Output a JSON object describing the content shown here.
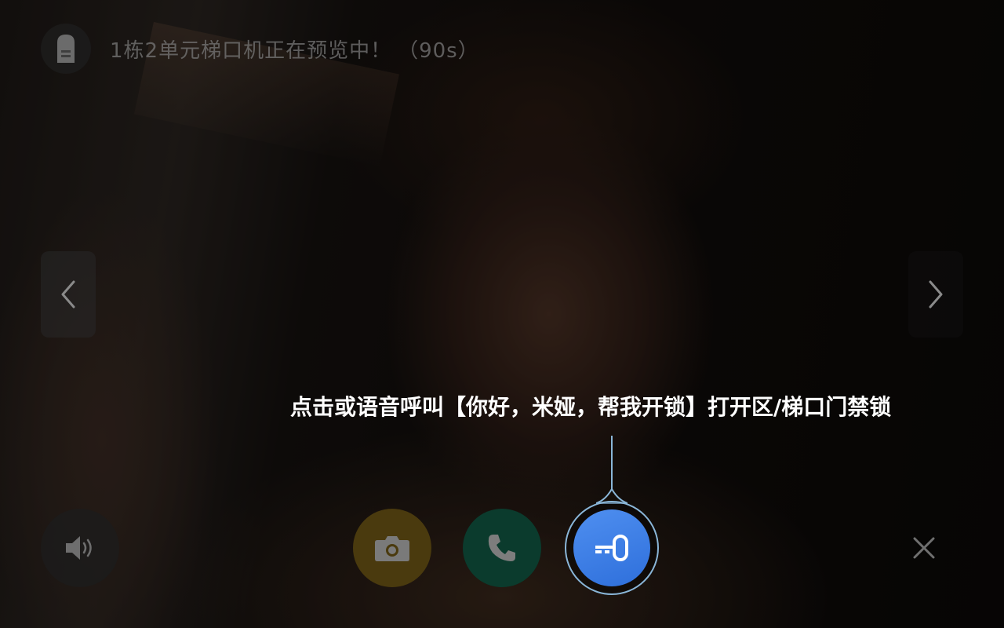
{
  "status": {
    "preview_text": "1栋2单元梯口机正在预览中！",
    "countdown": "（90s）"
  },
  "hint": {
    "text": "点击或语音呼叫【你好，米娅，帮我开锁】打开区/梯口门禁锁"
  },
  "icons": {
    "device": "intercom-device-icon",
    "prev": "chevron-left-icon",
    "next": "chevron-right-icon",
    "speaker": "speaker-icon",
    "snapshot": "camera-icon",
    "call": "phone-icon",
    "unlock": "key-icon",
    "close": "close-icon"
  },
  "colors": {
    "snapshot_button": "#4a3a0e",
    "call_button": "#0b3b2d",
    "unlock_button": "#3a7de6",
    "unlock_ring": "#8ab6d8",
    "hint_text": "#ffffff"
  }
}
